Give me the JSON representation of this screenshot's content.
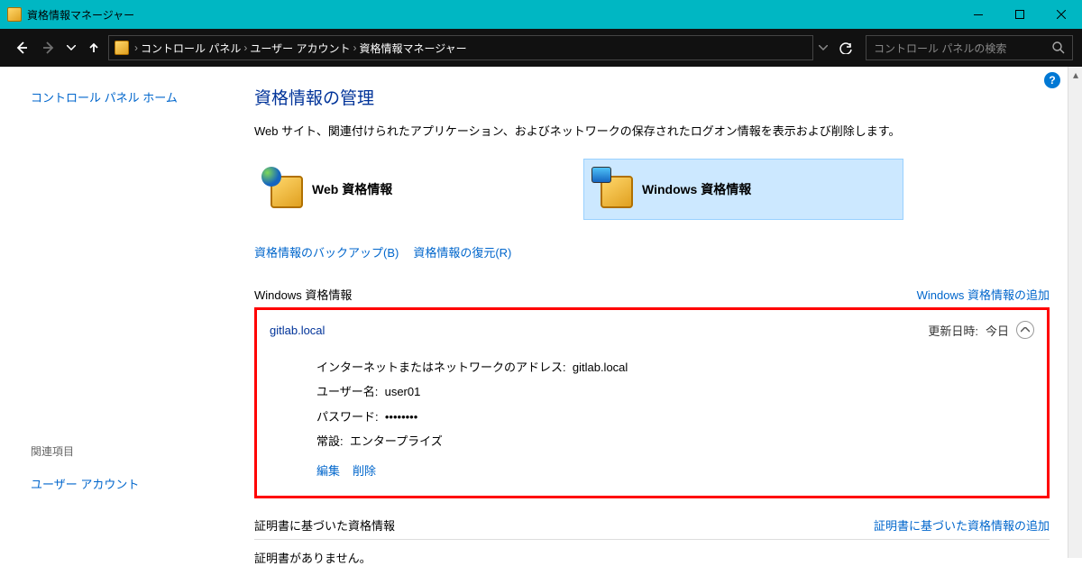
{
  "window": {
    "title": "資格情報マネージャー"
  },
  "breadcrumb": [
    "コントロール パネル",
    "ユーザー アカウント",
    "資格情報マネージャー"
  ],
  "search": {
    "placeholder": "コントロール パネルの検索"
  },
  "sidebar": {
    "home_link": "コントロール パネル ホーム",
    "related_label": "関連項目",
    "related_link": "ユーザー アカウント"
  },
  "page": {
    "title": "資格情報の管理",
    "desc": "Web サイト、関連付けられたアプリケーション、およびネットワークの保存されたログオン情報を表示および削除します。",
    "tile_web": "Web 資格情報",
    "tile_win": "Windows 資格情報",
    "backup": "資格情報のバックアップ(B)",
    "restore": "資格情報の復元(R)"
  },
  "section_win": {
    "header": "Windows 資格情報",
    "addlink": "Windows 資格情報の追加"
  },
  "entry": {
    "name": "gitlab.local",
    "updated_label": "更新日時:",
    "updated_value": "今日",
    "addr_label": "インターネットまたはネットワークのアドレス:",
    "addr_value": "gitlab.local",
    "user_label": "ユーザー名:",
    "user_value": "user01",
    "pass_label": "パスワード:",
    "pass_value": "••••••••",
    "persist_label": "常設:",
    "persist_value": "エンタープライズ",
    "edit": "編集",
    "delete": "削除"
  },
  "section_cert": {
    "header": "証明書に基づいた資格情報",
    "addlink": "証明書に基づいた資格情報の追加",
    "empty": "証明書がありません。"
  }
}
